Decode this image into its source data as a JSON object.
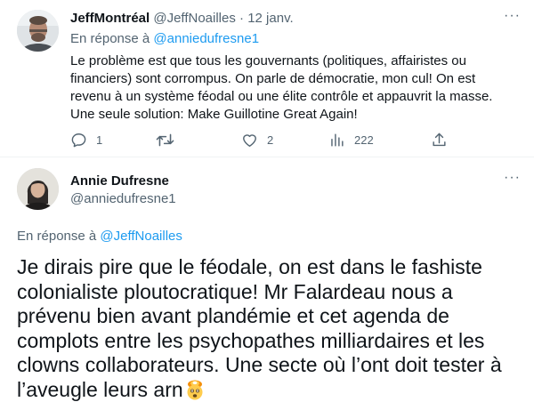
{
  "tweet1": {
    "author_name": "JeffMontréal",
    "author_handle": "@JeffNoailles",
    "date": "· 12 janv.",
    "replying_prefix": "En réponse à",
    "replying_to": "@anniedufresne1",
    "text": "Le problème est que tous les gouvernants (politiques, affairistes ou financiers) sont corrompus. On parle de démocratie, mon cul! On est revenu à un système féodal ou une élite contrôle et appauvrit la masse. Une seule solution: Make Guillotine Great Again!",
    "replies": "1",
    "retweets": "",
    "likes": "2",
    "views": "222",
    "more_label": "···"
  },
  "tweet2": {
    "author_name": "Annie Dufresne",
    "author_handle": "@anniedufresne1",
    "replying_prefix": "En réponse à",
    "replying_to": "@JeffNoailles",
    "text": "Je dirais pire que le féodale, on est dans le fashiste colonialiste ploutocratique! Mr Falardeau nous a prévenu bien avant plandémie et cet agenda de complots entre les psychopathes milliardaires et les clowns collaborateurs. Une secte où l’ont doit tester à l’aveugle leurs arn",
    "emoji": "exploding-head",
    "more_label": "···"
  },
  "icons": {
    "reply": "reply-icon",
    "retweet": "retweet-icon",
    "like": "heart-icon",
    "views": "analytics-icon",
    "share": "share-icon"
  },
  "colors": {
    "text": "#0f1419",
    "secondary": "#536471",
    "link": "#1d9bf0",
    "divider": "#eff3f4"
  }
}
